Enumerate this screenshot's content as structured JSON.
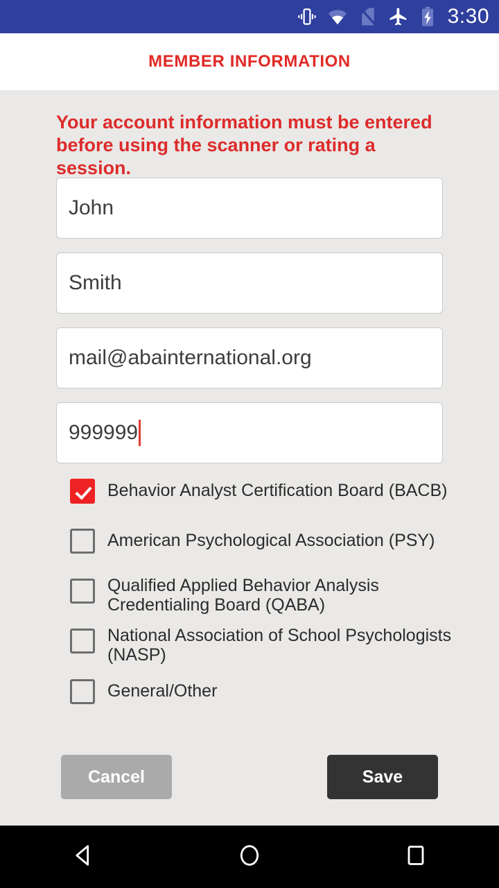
{
  "status_bar": {
    "clock": "3:30",
    "background": "#2f3f9e",
    "icons": [
      {
        "name": "vibrate-icon",
        "label": "vibrate"
      },
      {
        "name": "wifi-icon",
        "label": "wifi"
      },
      {
        "name": "no-sim-icon",
        "label": "no sim"
      },
      {
        "name": "airplane-mode-icon",
        "label": "airplane mode"
      },
      {
        "name": "battery-charging-icon",
        "label": "battery charging"
      }
    ]
  },
  "header": {
    "title": "MEMBER INFORMATION",
    "title_color": "#e02a26"
  },
  "main": {
    "warning": "Your account information must be entered before using the scanner or rating a session.",
    "warning_color": "#dd2b2b",
    "fields": [
      {
        "name": "first-name",
        "value": "John",
        "placeholder": "First Name"
      },
      {
        "name": "last-name",
        "value": "Smith",
        "placeholder": "Last Name"
      },
      {
        "name": "email",
        "value": "mail@abainternational.org",
        "placeholder": "Email"
      },
      {
        "name": "member-id",
        "value": "999999",
        "placeholder": "Member ID"
      }
    ],
    "focused_field": "member-id",
    "caret_color": "#e23a30",
    "checkboxes": [
      {
        "name": "bacb",
        "label": "Behavior Analyst Certification Board (BACB)",
        "checked": true
      },
      {
        "name": "psy",
        "label": "American Psychological Association (PSY)",
        "checked": false
      },
      {
        "name": "qaba",
        "label": "Qualified Applied Behavior Analysis Credentialing Board (QABA)",
        "checked": false
      },
      {
        "name": "nasp",
        "label": "National Association of School Psychologists (NASP)",
        "checked": false
      },
      {
        "name": "general-other",
        "label": "General/Other",
        "checked": false
      }
    ],
    "checked_color": "#ee2222",
    "buttons": {
      "cancel": {
        "label": "Cancel",
        "color": "#aaaaaa"
      },
      "save": {
        "label": "Save",
        "color": "#333333"
      }
    }
  },
  "nav_bar": {
    "back": "back-icon",
    "home": "home-icon",
    "recents": "recents-icon"
  }
}
